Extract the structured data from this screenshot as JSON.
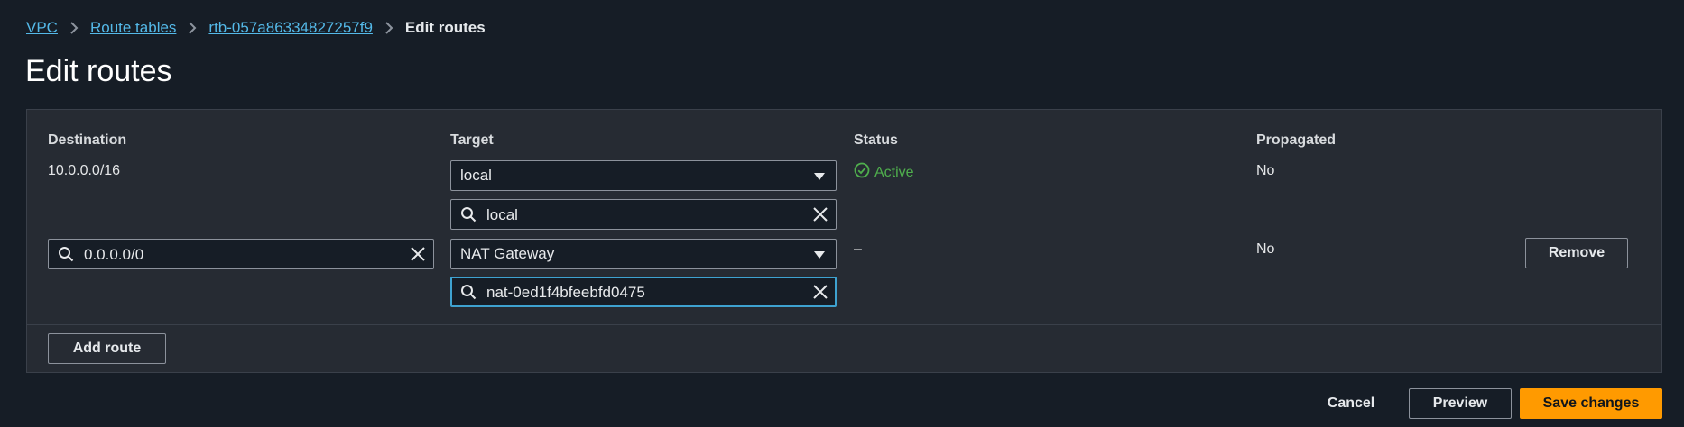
{
  "breadcrumb": {
    "items": [
      {
        "label": "VPC"
      },
      {
        "label": "Route tables"
      },
      {
        "label": "rtb-057a86334827257f9"
      },
      {
        "label": "Edit routes"
      }
    ]
  },
  "page": {
    "title": "Edit routes"
  },
  "table": {
    "headers": {
      "destination": "Destination",
      "target": "Target",
      "status": "Status",
      "propagated": "Propagated"
    },
    "rows": [
      {
        "destination": "10.0.0.0/16",
        "target_type": "local",
        "target_value": "local",
        "status": "Active",
        "propagated": "No"
      },
      {
        "destination": "0.0.0.0/0",
        "target_type": "NAT Gateway",
        "target_value": "nat-0ed1f4bfeebfd0475",
        "status": "–",
        "propagated": "No",
        "remove_label": "Remove"
      }
    ]
  },
  "buttons": {
    "add_route": "Add route",
    "cancel": "Cancel",
    "preview": "Preview",
    "save": "Save changes"
  },
  "colors": {
    "background": "#161d26",
    "panel": "#262b33",
    "link": "#54b9e8",
    "active": "#4fae4d",
    "primary": "#ff9a00",
    "focus": "#3ea2d0"
  },
  "icons": {
    "breadcrumb_separator": "chevron-right-icon",
    "select_caret": "caret-down-icon",
    "search": "search-icon",
    "clear": "close-icon",
    "status": "check-circle-icon"
  }
}
